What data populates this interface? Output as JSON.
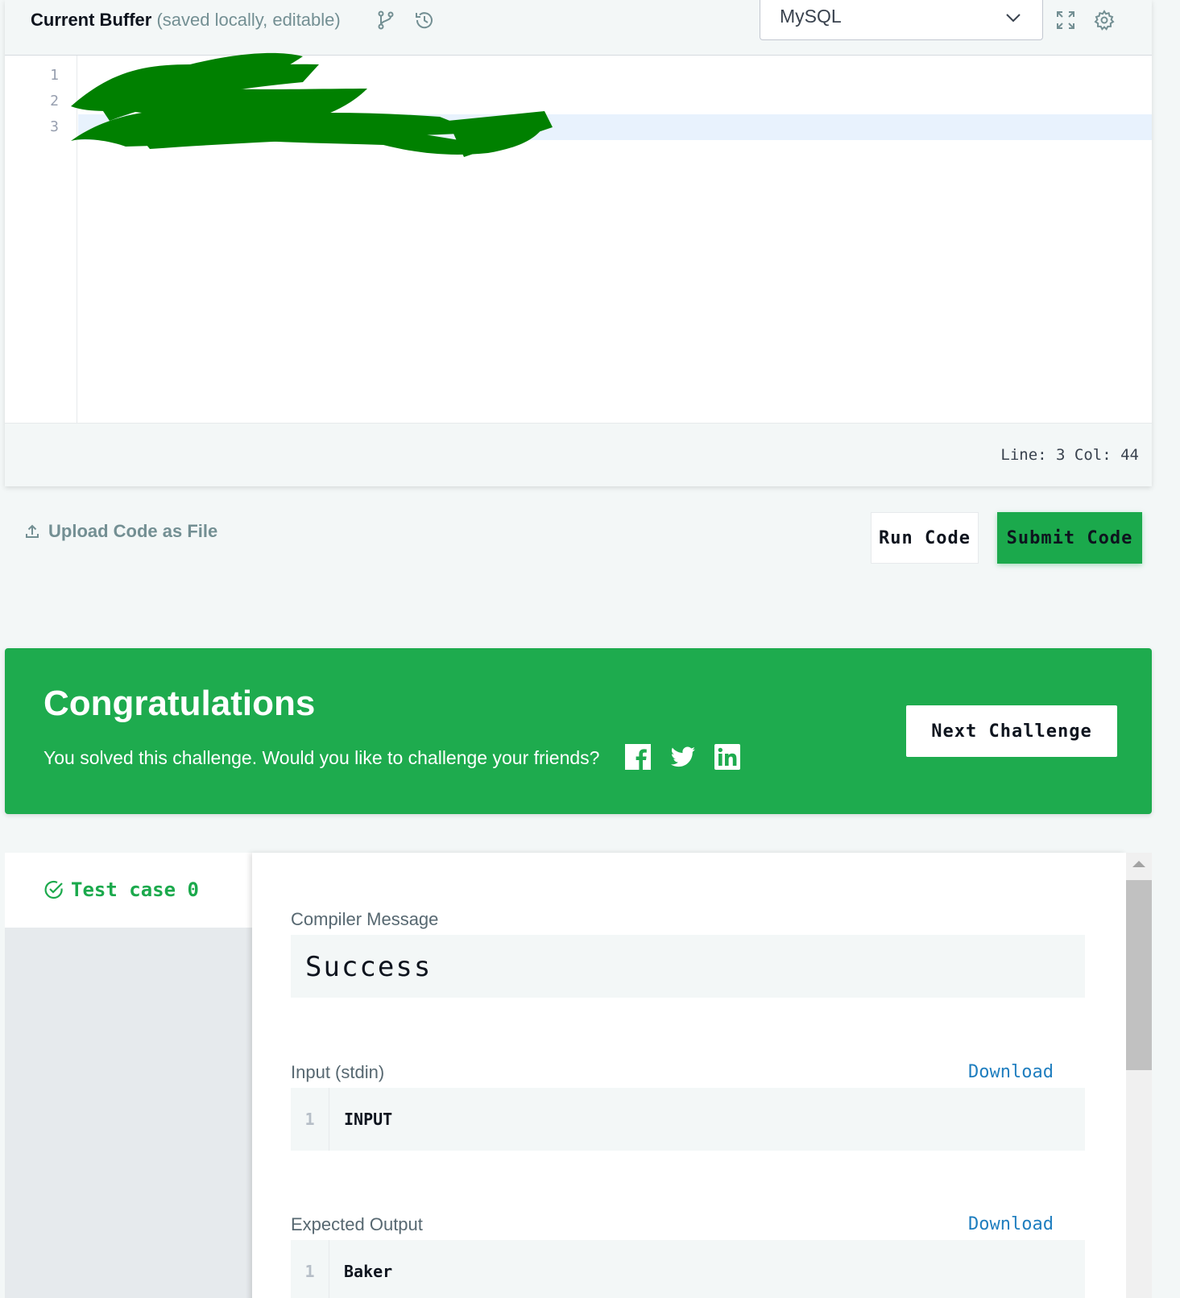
{
  "editor": {
    "title": "Current Buffer",
    "subtitle": "(saved locally, editable)",
    "icons": [
      "git-branch-icon",
      "history-icon",
      "expand-icon",
      "gear-icon"
    ],
    "language": "MySQL",
    "line_numbers": [
      "1",
      "2",
      "3"
    ],
    "redacted_code": true,
    "status": "Line: 3 Col: 44"
  },
  "actions": {
    "upload_label": "Upload Code as File",
    "run_label": "Run Code",
    "submit_label": "Submit Code"
  },
  "banner": {
    "title": "Congratulations",
    "message": "You solved this challenge. Would you like to challenge your friends?",
    "social_icons": [
      "facebook-icon",
      "twitter-icon",
      "linkedin-icon"
    ],
    "next_label": "Next Challenge",
    "color": "#1eab4e"
  },
  "test_case": {
    "tab_label": "Test case 0",
    "compiler_label": "Compiler Message",
    "compiler_message": "Success",
    "input_label": "Input (stdin)",
    "input_download": "Download",
    "input_line_no": "1",
    "input_value": "INPUT",
    "expected_label": "Expected Output",
    "expected_download": "Download",
    "expected_line_no": "1",
    "expected_value": "Baker",
    "success_color": "#1ba94c",
    "link_color": "#1f7ebf"
  }
}
